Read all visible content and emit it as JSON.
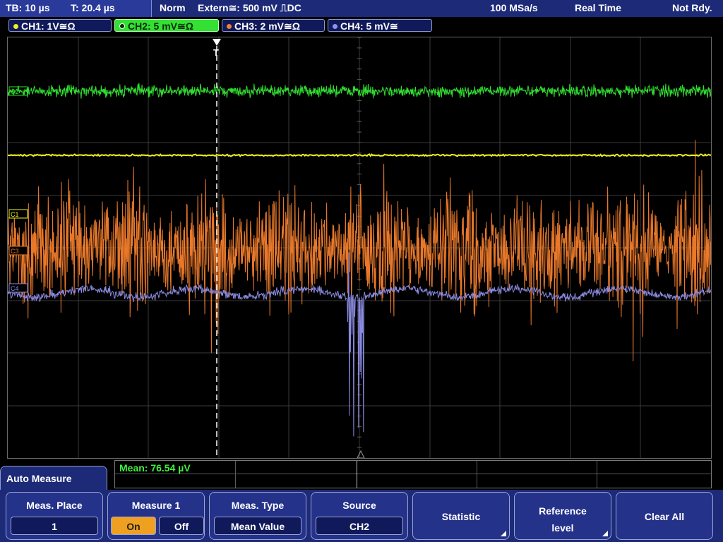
{
  "status": {
    "timebase": "TB: 10 µs",
    "trigger_time": "T: 20.4 µs",
    "mode": "Norm",
    "trigger_source": "Extern≅: 500 mV ⎍DC",
    "sample_rate": "100 MSa/s",
    "acq_mode": "Real Time",
    "state": "Not Rdy."
  },
  "channels": [
    {
      "label": "CH1: 1V≅Ω",
      "color": "#f0f020"
    },
    {
      "label": "CH2: 5 mV≅Ω",
      "color": "#33e033"
    },
    {
      "label": "CH3: 2 mV≅Ω",
      "color": "#f08030"
    },
    {
      "label": "CH4: 5 mV≅",
      "color": "#9090f0"
    }
  ],
  "markers": {
    "c1": "C1",
    "c2": "C2",
    "c3": "C3",
    "c4": "C4",
    "trigger": "T"
  },
  "measurement": {
    "result": "Mean: 76.54 µV"
  },
  "panel": {
    "title": "Auto Measure"
  },
  "softkeys": {
    "meas_place": {
      "label": "Meas. Place",
      "value": "1"
    },
    "measure1": {
      "label": "Measure 1",
      "on": "On",
      "off": "Off"
    },
    "meas_type": {
      "label": "Meas. Type",
      "value": "Mean Value"
    },
    "source": {
      "label": "Source",
      "value": "CH2"
    },
    "statistic": {
      "label": "Statistic"
    },
    "reference": {
      "label": "Reference level"
    },
    "clear": {
      "label": "Clear All"
    }
  }
}
